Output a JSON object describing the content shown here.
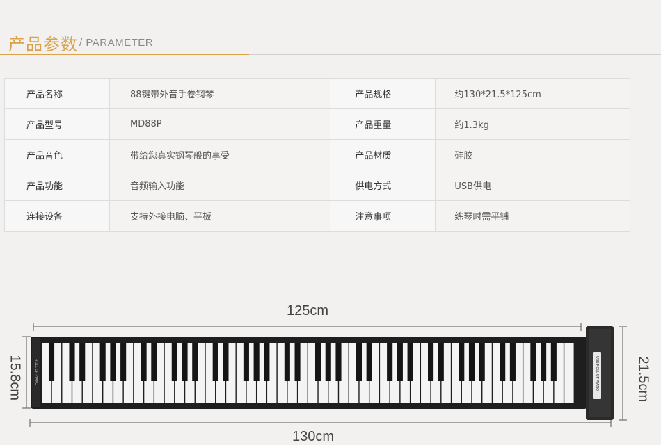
{
  "header": {
    "title_zh": "产品参数",
    "title_en": "/ PARAMETER"
  },
  "params": [
    {
      "label1": "产品名称",
      "value1": "88键带外音手卷钢琴",
      "label2": "产品规格",
      "value2": "约130*21.5*125cm"
    },
    {
      "label1": "产品型号",
      "value1": "MD88P",
      "label2": "产品重量",
      "value2": "约1.3kg"
    },
    {
      "label1": "产品音色",
      "value1": "带给您真实钢琴般的享受",
      "label2": "产品材质",
      "value2": "硅胶"
    },
    {
      "label1": "产品功能",
      "value1": "音频输入功能",
      "label2": "供电方式",
      "value2": "USB供电"
    },
    {
      "label1": "连接设备",
      "value1": "支持外接电脑、平板",
      "label2": "注意事项",
      "value2": "练琴时需平铺"
    }
  ],
  "diagram": {
    "dim_top": "125cm",
    "dim_bottom": "130cm",
    "dim_left": "15.8cm",
    "dim_right": "21.5cm",
    "module_label": "USB ROLL UP PIANO",
    "left_label": "ROLL UP PIANO"
  },
  "colors": {
    "accent": "#d9a24a",
    "piano_body": "#1e1e1e",
    "white_key": "#f4f4f4"
  }
}
